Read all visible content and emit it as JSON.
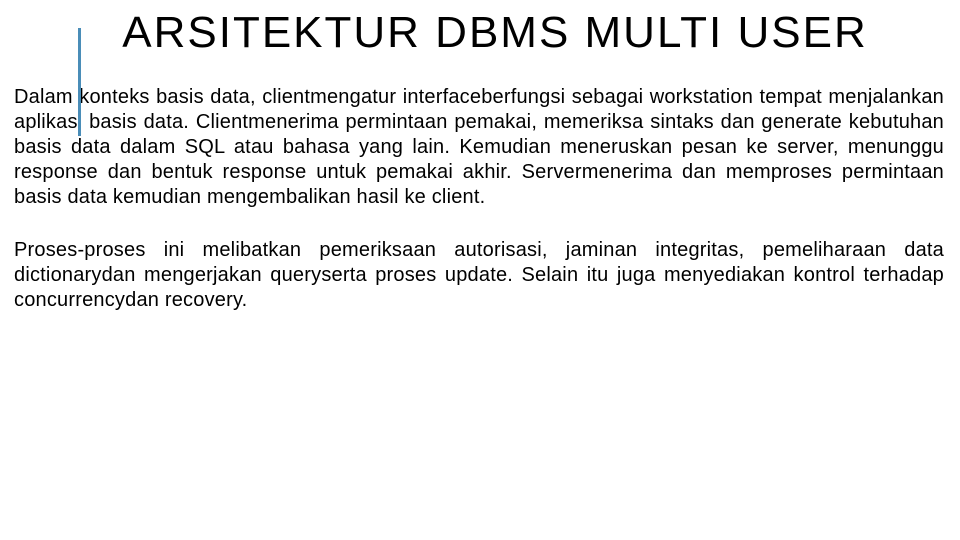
{
  "title": "ARSITEKTUR DBMS MULTI USER",
  "paragraphs": [
    "Dalam konteks basis data, clientmengatur interfaceberfungsi sebagai workstation tempat menjalankan aplikasi basis data.  Clientmenerima permintaan pemakai, memeriksa sintaks dan generate kebutuhan basis data dalam SQL atau bahasa yang lain. Kemudian meneruskan pesan ke  server, menunggu  response dan bentuk response untuk pemakai akhir. Servermenerima dan memproses permintaan basis data kemudian mengembalikan hasil ke client.",
    "Proses-proses ini melibatkan pemeriksaan autorisasi, jaminan integritas, pemeliharaan data dictionarydan mengerjakan queryserta proses update. Selain itu juga menyediakan kontrol terhadap concurrencydan recovery."
  ]
}
